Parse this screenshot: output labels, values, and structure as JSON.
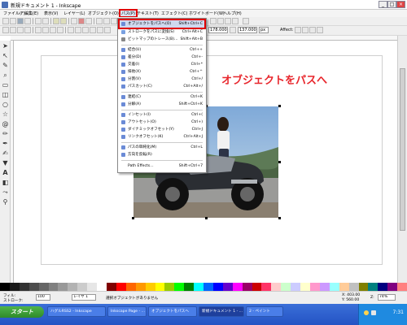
{
  "window": {
    "title": "新規ドキュメント 1 - Inkscape"
  },
  "menubar": {
    "items": [
      "ファイル(F)",
      "編集(E)",
      "表示(V)",
      "レイヤー(L)",
      "オブジェクト(O)",
      "パス(P)",
      "テキスト(T)",
      "エフェクト(C)",
      "ホワイトボード(W)",
      "ヘルプ(H)"
    ],
    "active_index": 5
  },
  "path_menu": {
    "items": [
      {
        "label": "オブジェクトをパスへ(O)",
        "shortcut": "Shift+Ctrl+C",
        "icon": "object-to-path-icon",
        "highlighted": true
      },
      {
        "label": "ストロークをパスに変換(S)",
        "shortcut": "Ctrl+Alt+C",
        "icon": "stroke-to-path-icon"
      },
      {
        "label": "ビットマップのトレース(B)...",
        "shortcut": "Shift+Alt+B",
        "icon": "trace-bitmap-icon"
      },
      {
        "label": "結合(U)",
        "shortcut": "Ctrl++",
        "icon": "union-icon"
      },
      {
        "label": "差分(D)",
        "shortcut": "Ctrl+-",
        "icon": "difference-icon"
      },
      {
        "label": "交差(I)",
        "shortcut": "Ctrl+*",
        "icon": "intersection-icon"
      },
      {
        "label": "排他(X)",
        "shortcut": "Ctrl+^",
        "icon": "exclusion-icon"
      },
      {
        "label": "分割(V)",
        "shortcut": "Ctrl+/",
        "icon": "division-icon"
      },
      {
        "label": "パスカット(C)",
        "shortcut": "Ctrl+Alt+/",
        "icon": "cut-path-icon"
      },
      {
        "label": "連結(C)",
        "shortcut": "Ctrl+K",
        "icon": "combine-icon"
      },
      {
        "label": "分解(A)",
        "shortcut": "Shift+Ctrl+K",
        "icon": "break-apart-icon"
      },
      {
        "label": "インセット(I)",
        "shortcut": "Ctrl+(",
        "icon": "inset-icon"
      },
      {
        "label": "アウトセット(O)",
        "shortcut": "Ctrl+)",
        "icon": "outset-icon"
      },
      {
        "label": "ダイナミックオフセット(Y)",
        "shortcut": "Ctrl+J",
        "icon": "dynamic-offset-icon"
      },
      {
        "label": "リンクオフセット(K)",
        "shortcut": "Ctrl+Alt+J",
        "icon": "linked-offset-icon"
      },
      {
        "label": "パスの単純化(M)",
        "shortcut": "Ctrl+L",
        "icon": "simplify-icon"
      },
      {
        "label": "方向を反転(R)",
        "shortcut": "",
        "icon": "reverse-icon"
      },
      {
        "label": "Path Effects...",
        "shortcut": "Shift+Ctrl+7",
        "icon": ""
      }
    ]
  },
  "canvas": {
    "overlay_heading": "オブジェクトをパスへ"
  },
  "statusbar": {
    "fill_label": "フィル:",
    "stroke_label": "ストローク:",
    "opacity_value": "100",
    "layer_value": "レイヤ 1",
    "message": "選択オブジェクトがありません",
    "coords_x": "X: 403.00",
    "coords_y": "Y: 560.00",
    "zoom_label": "Z:",
    "zoom_value": "74%"
  },
  "toolbar2": {
    "w_value": "178.000",
    "h_value": "137.000",
    "units": "px",
    "affect_label": "Affect:"
  },
  "taskbar": {
    "start_label": "スタート",
    "tasks": [
      "ハグルRSS2 - Inkscape",
      "Inkscape Page - ...",
      "オブジェクトをパスへ",
      "新規ドキュメント 1 - ...",
      "2 - ペイント"
    ],
    "active_task": 3,
    "clock": "7:31"
  },
  "palette": {
    "colors": [
      "#000000",
      "#1a1a1a",
      "#333333",
      "#4d4d4d",
      "#666666",
      "#808080",
      "#999999",
      "#b3b3b3",
      "#cccccc",
      "#e6e6e6",
      "#ffffff",
      "#800000",
      "#ff0000",
      "#ff6600",
      "#ff9900",
      "#ffcc00",
      "#ffff00",
      "#99cc00",
      "#00ff00",
      "#008000",
      "#00ffff",
      "#0066ff",
      "#0000ff",
      "#6600cc",
      "#ff00ff",
      "#990066",
      "#cc0000",
      "#ff3366",
      "#ffcccc",
      "#ccffcc",
      "#ccccff",
      "#ffffcc",
      "#ff99cc",
      "#cc99ff",
      "#99ffff",
      "#ffcc99",
      "#c0c0c0",
      "#808000",
      "#008080",
      "#000080",
      "#800080",
      "#ff8080"
    ]
  }
}
